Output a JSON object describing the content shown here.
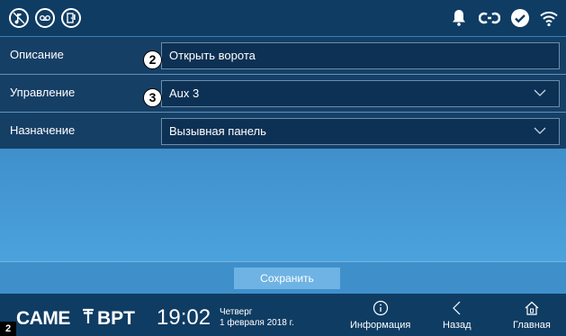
{
  "status_bar": {
    "left_icons": [
      "mute-ringer-icon",
      "voicemail-icon",
      "door-open-icon"
    ],
    "right_icons": [
      "bell-icon",
      "link-icon",
      "check-circle-icon",
      "wifi-icon"
    ]
  },
  "form": {
    "description": {
      "label": "Описание",
      "value": "Открыть ворота",
      "marker": "2"
    },
    "control": {
      "label": "Управление",
      "value": "Aux 3",
      "marker": "3"
    },
    "destination": {
      "label": "Назначение",
      "value": "Вызывная панель"
    }
  },
  "save_label": "Сохранить",
  "footer": {
    "brand_came": "CAME",
    "brand_bpt": "BPT",
    "time": "19:02",
    "day": "Четверг",
    "date": "1 февраля 2018 г.",
    "nav": {
      "info": "Информация",
      "back": "Назад",
      "home": "Главная"
    }
  },
  "figure_number": "2"
}
